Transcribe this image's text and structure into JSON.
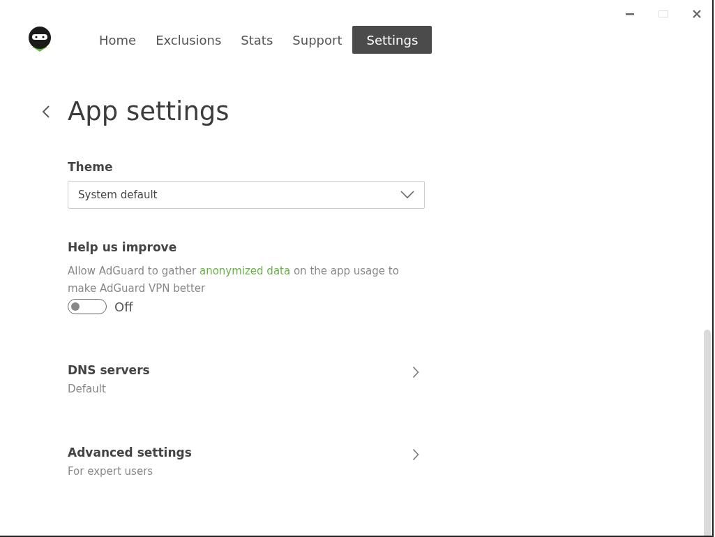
{
  "window": {
    "controls": [
      {
        "kind": "minimize",
        "disabled": false
      },
      {
        "kind": "maximize",
        "disabled": true
      },
      {
        "kind": "close",
        "disabled": false
      }
    ]
  },
  "tabs": [
    {
      "label": "Home",
      "selected": false
    },
    {
      "label": "Exclusions",
      "selected": false
    },
    {
      "label": "Stats",
      "selected": false
    },
    {
      "label": "Support",
      "selected": false
    },
    {
      "label": "Settings",
      "selected": true
    }
  ],
  "page": {
    "title": "App settings"
  },
  "theme": {
    "label": "Theme",
    "value": "System default"
  },
  "help": {
    "label": "Help us improve",
    "text_before": "Allow AdGuard to gather ",
    "link": "anonymized data",
    "text_after": " on the app usage to make AdGuard VPN better",
    "toggle": {
      "on": false,
      "label": "Off"
    }
  },
  "links": [
    {
      "title": "DNS servers",
      "subtitle": "Default"
    },
    {
      "title": "Advanced settings",
      "subtitle": "For expert users"
    }
  ]
}
